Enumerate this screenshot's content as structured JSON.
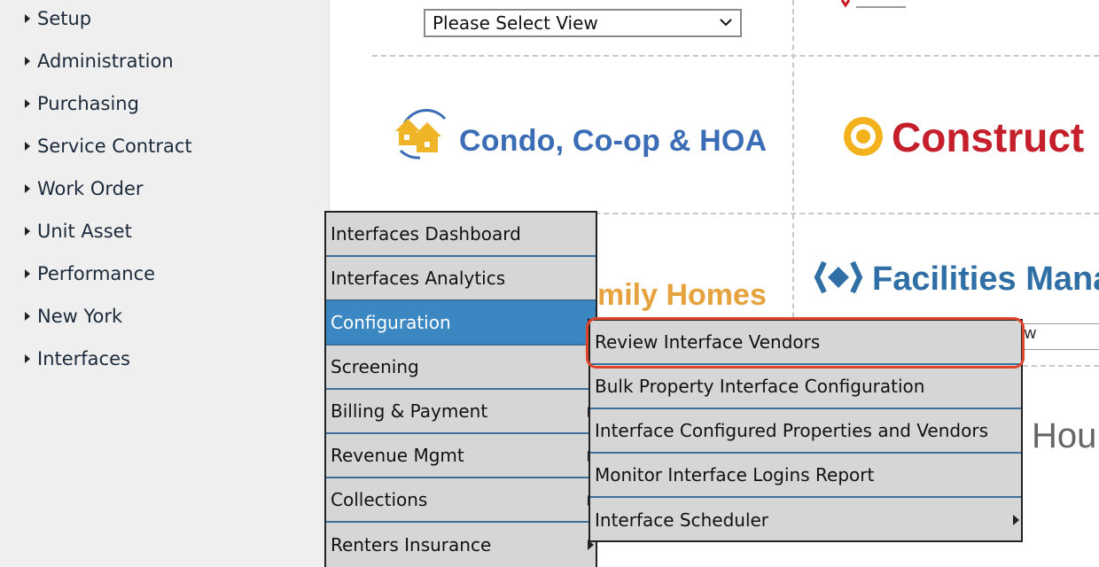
{
  "sidebar": {
    "items": [
      {
        "label": "Setup"
      },
      {
        "label": "Administration"
      },
      {
        "label": "Purchasing"
      },
      {
        "label": "Service Contract"
      },
      {
        "label": "Work Order"
      },
      {
        "label": "Unit Asset"
      },
      {
        "label": "Performance"
      },
      {
        "label": "New York"
      },
      {
        "label": "Interfaces"
      }
    ]
  },
  "main": {
    "view_select": {
      "value": "Please Select View"
    },
    "logos": {
      "condo": "Condo, Co-op & HOA",
      "construction": "Construct",
      "family_homes": "mily Homes",
      "facilities": "Facilities Manag",
      "partial_box": "w",
      "hou": "Hou"
    }
  },
  "menu_primary": {
    "items": [
      {
        "label": "Interfaces Dashboard"
      },
      {
        "label": "Interfaces Analytics"
      },
      {
        "label": "Configuration"
      },
      {
        "label": "Screening"
      },
      {
        "label": "Billing & Payment"
      },
      {
        "label": "Revenue Mgmt"
      },
      {
        "label": "Collections"
      },
      {
        "label": "Renters Insurance"
      }
    ]
  },
  "menu_submenu": {
    "items": [
      {
        "label": "Review Interface Vendors"
      },
      {
        "label": "Bulk Property Interface Configuration"
      },
      {
        "label": "Interface Configured Properties and Vendors"
      },
      {
        "label": "Monitor Interface Logins Report"
      },
      {
        "label": "Interface Scheduler"
      }
    ]
  },
  "colors": {
    "menu_active_bg": "#3a87c2",
    "highlight_ring": "#e0442a",
    "menu_bg": "#d6d6d6"
  }
}
